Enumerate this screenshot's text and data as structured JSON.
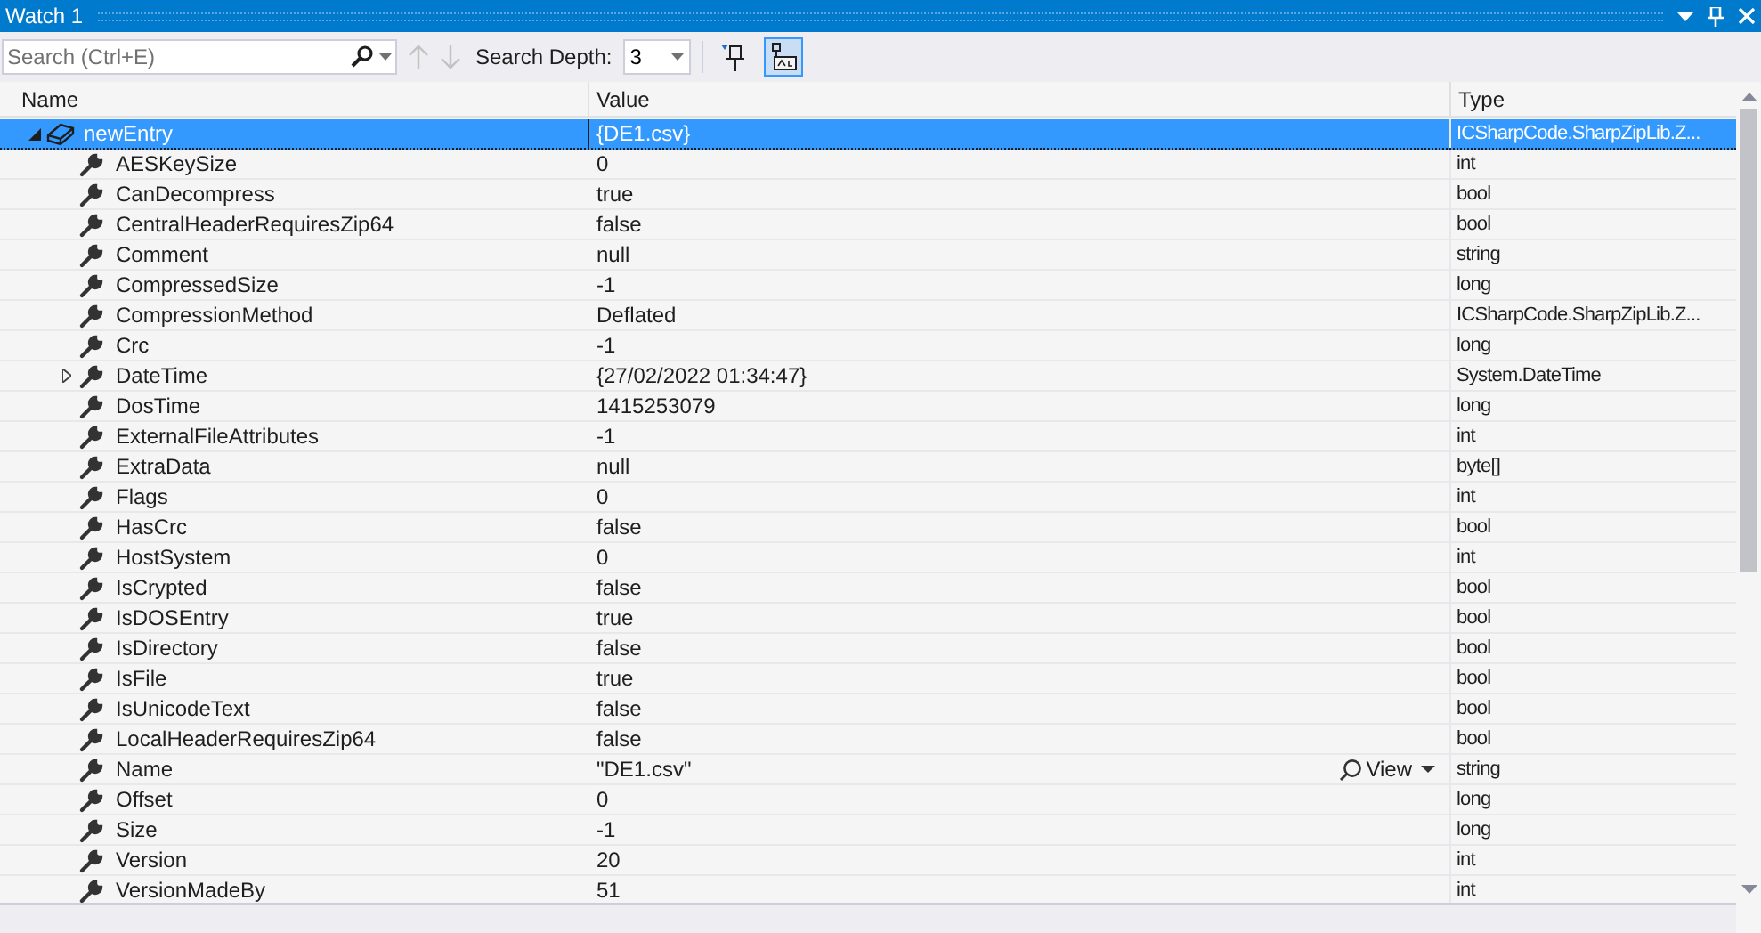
{
  "window": {
    "title": "Watch 1"
  },
  "toolbar": {
    "search": {
      "placeholder": "Search (Ctrl+E)"
    },
    "search_depth": {
      "label": "Search Depth:",
      "value": "3"
    },
    "pin_toggle": {
      "selected": false
    },
    "hex_toggle": {
      "selected": true
    }
  },
  "table": {
    "columns": [
      "Name",
      "Value",
      "Type"
    ],
    "rows": [
      {
        "name": "newEntry",
        "value": "{DE1.csv}",
        "type": "ICSharpCode.SharpZipLib.Z...",
        "selected": true,
        "expanded": true,
        "children": [
          {
            "name": "AESKeySize",
            "value": "0",
            "type": "int",
            "selected": false
          },
          {
            "name": "CanDecompress",
            "value": "true",
            "type": "bool",
            "selected": false
          },
          {
            "name": "CentralHeaderRequiresZip64",
            "value": "false",
            "type": "bool",
            "selected": false
          },
          {
            "name": "Comment",
            "value": "null",
            "type": "string",
            "selected": false
          },
          {
            "name": "CompressedSize",
            "value": "-1",
            "type": "long",
            "selected": false
          },
          {
            "name": "CompressionMethod",
            "value": "Deflated",
            "type": "ICSharpCode.SharpZipLib.Z...",
            "selected": false
          },
          {
            "name": "Crc",
            "value": "-1",
            "type": "long",
            "selected": false
          },
          {
            "name": "DateTime",
            "value": "{27/02/2022 01:34:47}",
            "type": "System.DateTime",
            "selected": false,
            "expanded": false
          },
          {
            "name": "DosTime",
            "value": "1415253079",
            "type": "long",
            "selected": false
          },
          {
            "name": "ExternalFileAttributes",
            "value": "-1",
            "type": "int",
            "selected": false
          },
          {
            "name": "ExtraData",
            "value": "null",
            "type": "byte[]",
            "selected": false
          },
          {
            "name": "Flags",
            "value": "0",
            "type": "int",
            "selected": false
          },
          {
            "name": "HasCrc",
            "value": "false",
            "type": "bool",
            "selected": false
          },
          {
            "name": "HostSystem",
            "value": "0",
            "type": "int",
            "selected": false
          },
          {
            "name": "IsCrypted",
            "value": "false",
            "type": "bool",
            "selected": false
          },
          {
            "name": "IsDOSEntry",
            "value": "true",
            "type": "bool",
            "selected": false
          },
          {
            "name": "IsDirectory",
            "value": "false",
            "type": "bool",
            "selected": false
          },
          {
            "name": "IsFile",
            "value": "true",
            "type": "bool",
            "selected": false
          },
          {
            "name": "IsUnicodeText",
            "value": "false",
            "type": "bool",
            "selected": false
          },
          {
            "name": "LocalHeaderRequiresZip64",
            "value": "false",
            "type": "bool",
            "selected": false
          },
          {
            "name": "Name",
            "value": "\"DE1.csv\"",
            "type": "string",
            "selected": false,
            "visualizer": "View"
          },
          {
            "name": "Offset",
            "value": "0",
            "type": "long",
            "selected": false
          },
          {
            "name": "Size",
            "value": "-1",
            "type": "long",
            "selected": false
          },
          {
            "name": "Version",
            "value": "20",
            "type": "int",
            "selected": false
          },
          {
            "name": "VersionMadeBy",
            "value": "51",
            "type": "int",
            "selected": false
          }
        ]
      }
    ]
  }
}
